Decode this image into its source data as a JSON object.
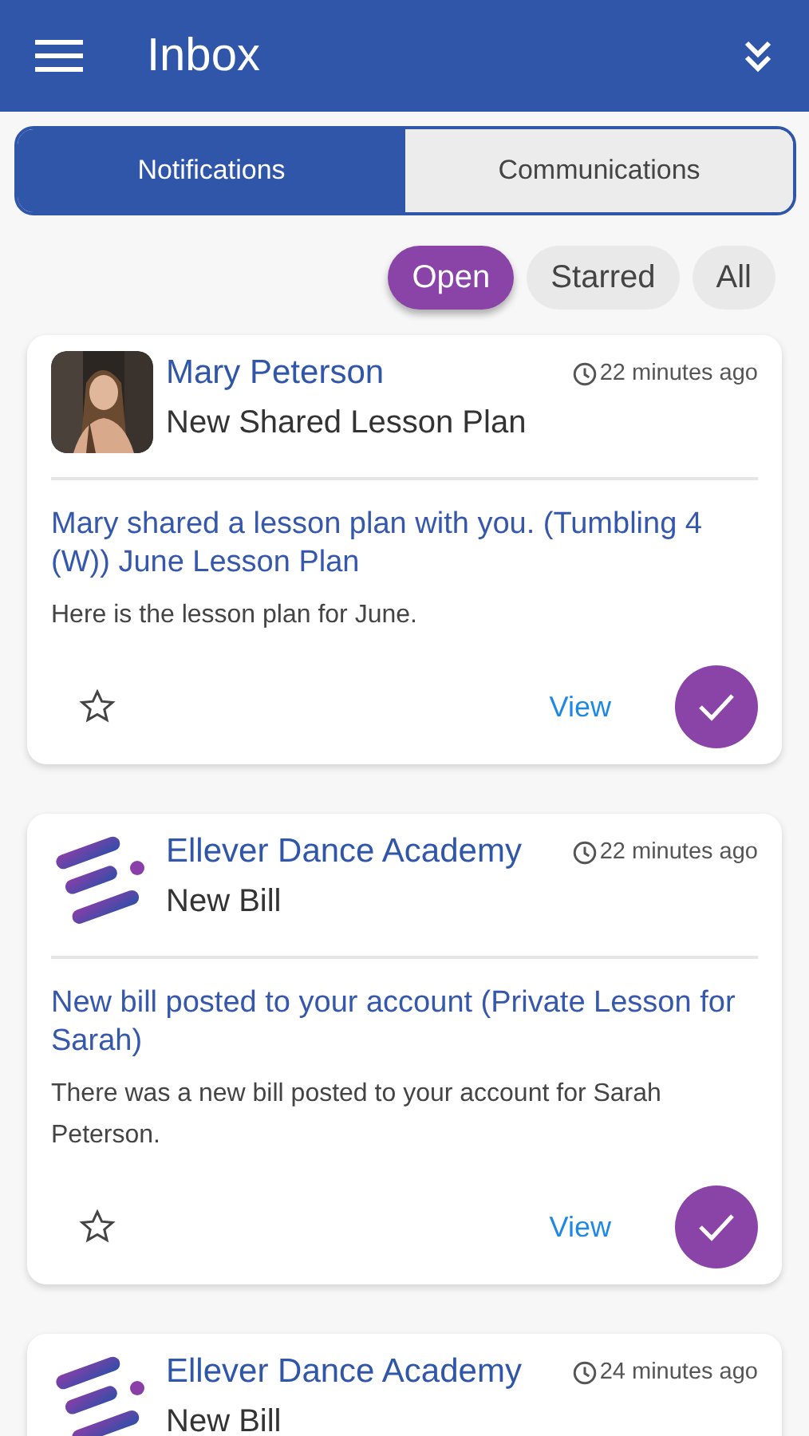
{
  "app_bar": {
    "title": "Inbox"
  },
  "tabs": [
    {
      "label": "Notifications",
      "selected": true
    },
    {
      "label": "Communications",
      "selected": false
    }
  ],
  "filters": [
    {
      "label": "Open",
      "selected": true
    },
    {
      "label": "Starred",
      "selected": false
    },
    {
      "label": "All",
      "selected": false
    }
  ],
  "notifications": [
    {
      "sender": "Mary Peterson",
      "time": "22 minutes ago",
      "subject": "New Shared Lesson Plan",
      "message": "Mary shared a lesson plan with you. (Tumbling 4 (W)) June Lesson Plan",
      "body": "Here is the lesson plan for June.",
      "starred": false,
      "action": "View"
    },
    {
      "avatar": {
        "kind": "logo"
      },
      "sender": "Ellever Dance Academy",
      "time": "22 minutes ago",
      "subject": "New Bill",
      "message": "New bill posted to your account (Private Lesson for Sarah)",
      "body": "There was a new bill posted to your account for Sarah Peterson.",
      "starred": false,
      "action": "View"
    },
    {
      "avatar": {
        "kind": "logo"
      },
      "sender": "Ellever Dance Academy",
      "time": "24 minutes ago",
      "subject": "New Bill"
    }
  ]
}
